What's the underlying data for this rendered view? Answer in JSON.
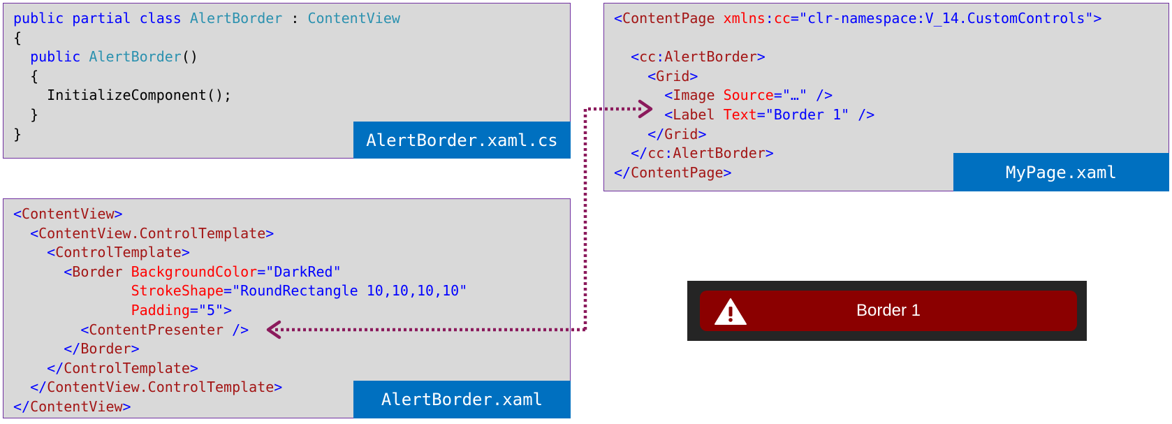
{
  "panels": {
    "code_behind": {
      "filename": "AlertBorder.xaml.cs",
      "lines": [
        [
          [
            "kw",
            "public partial class "
          ],
          [
            "ty",
            "AlertBorder"
          ],
          [
            "tx",
            " : "
          ],
          [
            "ty",
            "ContentView"
          ]
        ],
        [
          [
            "tx",
            "{"
          ]
        ],
        [
          [
            "tx",
            "  "
          ],
          [
            "kw",
            "public "
          ],
          [
            "ty",
            "AlertBorder"
          ],
          [
            "tx",
            "()"
          ]
        ],
        [
          [
            "tx",
            "  {"
          ]
        ],
        [
          [
            "tx",
            "    InitializeComponent();"
          ]
        ],
        [
          [
            "tx",
            "  }"
          ]
        ],
        [
          [
            "tx",
            "}"
          ]
        ]
      ]
    },
    "page": {
      "filename": "MyPage.xaml",
      "lines": [
        [
          [
            "pn",
            "<"
          ],
          [
            "tg",
            "ContentPage"
          ],
          [
            "tx",
            " "
          ],
          [
            "at",
            "xmlns"
          ],
          [
            "pn",
            ":"
          ],
          [
            "at",
            "cc"
          ],
          [
            "pn",
            "=\""
          ],
          [
            "av",
            "clr-namespace:V_14.CustomControls"
          ],
          [
            "pn",
            "\">"
          ]
        ],
        [
          [
            "tx",
            ""
          ]
        ],
        [
          [
            "tx",
            "  "
          ],
          [
            "pn",
            "<"
          ],
          [
            "tg",
            "cc"
          ],
          [
            "pn",
            ":"
          ],
          [
            "tg",
            "AlertBorder"
          ],
          [
            "pn",
            ">"
          ]
        ],
        [
          [
            "tx",
            "    "
          ],
          [
            "pn",
            "<"
          ],
          [
            "tg",
            "Grid"
          ],
          [
            "pn",
            ">"
          ]
        ],
        [
          [
            "tx",
            "      "
          ],
          [
            "pn",
            "<"
          ],
          [
            "tg",
            "Image"
          ],
          [
            "tx",
            " "
          ],
          [
            "at",
            "Source"
          ],
          [
            "pn",
            "=\""
          ],
          [
            "av",
            "…"
          ],
          [
            "pn",
            "\" />"
          ]
        ],
        [
          [
            "tx",
            "      "
          ],
          [
            "pn",
            "<"
          ],
          [
            "tg",
            "Label"
          ],
          [
            "tx",
            " "
          ],
          [
            "at",
            "Text"
          ],
          [
            "pn",
            "=\""
          ],
          [
            "av",
            "Border 1"
          ],
          [
            "pn",
            "\" />"
          ]
        ],
        [
          [
            "tx",
            "    "
          ],
          [
            "pn",
            "</"
          ],
          [
            "tg",
            "Grid"
          ],
          [
            "pn",
            ">"
          ]
        ],
        [
          [
            "tx",
            "  "
          ],
          [
            "pn",
            "</"
          ],
          [
            "tg",
            "cc"
          ],
          [
            "pn",
            ":"
          ],
          [
            "tg",
            "AlertBorder"
          ],
          [
            "pn",
            ">"
          ]
        ],
        [
          [
            "pn",
            "</"
          ],
          [
            "tg",
            "ContentPage"
          ],
          [
            "pn",
            ">"
          ]
        ]
      ]
    },
    "template": {
      "filename": "AlertBorder.xaml",
      "lines": [
        [
          [
            "pn",
            "<"
          ],
          [
            "tg",
            "ContentView"
          ],
          [
            "pn",
            ">"
          ]
        ],
        [
          [
            "tx",
            "  "
          ],
          [
            "pn",
            "<"
          ],
          [
            "tg",
            "ContentView.ControlTemplate"
          ],
          [
            "pn",
            ">"
          ]
        ],
        [
          [
            "tx",
            "    "
          ],
          [
            "pn",
            "<"
          ],
          [
            "tg",
            "ControlTemplate"
          ],
          [
            "pn",
            ">"
          ]
        ],
        [
          [
            "tx",
            "      "
          ],
          [
            "pn",
            "<"
          ],
          [
            "tg",
            "Border"
          ],
          [
            "tx",
            " "
          ],
          [
            "at",
            "BackgroundColor"
          ],
          [
            "pn",
            "=\""
          ],
          [
            "av",
            "DarkRed"
          ],
          [
            "pn",
            "\""
          ]
        ],
        [
          [
            "tx",
            "              "
          ],
          [
            "at",
            "StrokeShape"
          ],
          [
            "pn",
            "=\""
          ],
          [
            "av",
            "RoundRectangle 10,10,10,10"
          ],
          [
            "pn",
            "\""
          ]
        ],
        [
          [
            "tx",
            "              "
          ],
          [
            "at",
            "Padding"
          ],
          [
            "pn",
            "=\""
          ],
          [
            "av",
            "5"
          ],
          [
            "pn",
            "\">"
          ]
        ],
        [
          [
            "tx",
            "        "
          ],
          [
            "pn",
            "<"
          ],
          [
            "tg",
            "ContentPresenter"
          ],
          [
            "tx",
            " "
          ],
          [
            "pn",
            "/>"
          ]
        ],
        [
          [
            "tx",
            "      "
          ],
          [
            "pn",
            "</"
          ],
          [
            "tg",
            "Border"
          ],
          [
            "pn",
            ">"
          ]
        ],
        [
          [
            "tx",
            "    "
          ],
          [
            "pn",
            "</"
          ],
          [
            "tg",
            "ControlTemplate"
          ],
          [
            "pn",
            ">"
          ]
        ],
        [
          [
            "tx",
            "  "
          ],
          [
            "pn",
            "</"
          ],
          [
            "tg",
            "ContentView.ControlTemplate"
          ],
          [
            "pn",
            ">"
          ]
        ],
        [
          [
            "pn",
            "</"
          ],
          [
            "tg",
            "ContentView"
          ],
          [
            "pn",
            ">"
          ]
        ]
      ]
    }
  },
  "preview": {
    "icon": "warning-triangle-icon",
    "label": "Border 1",
    "background": "#252525",
    "border_color": "#8b0000"
  },
  "colors": {
    "panel_bg": "#d9d9d9",
    "panel_border": "#7030a0",
    "filename_tab": "#0070c0",
    "arrow": "#8b1a5c"
  }
}
